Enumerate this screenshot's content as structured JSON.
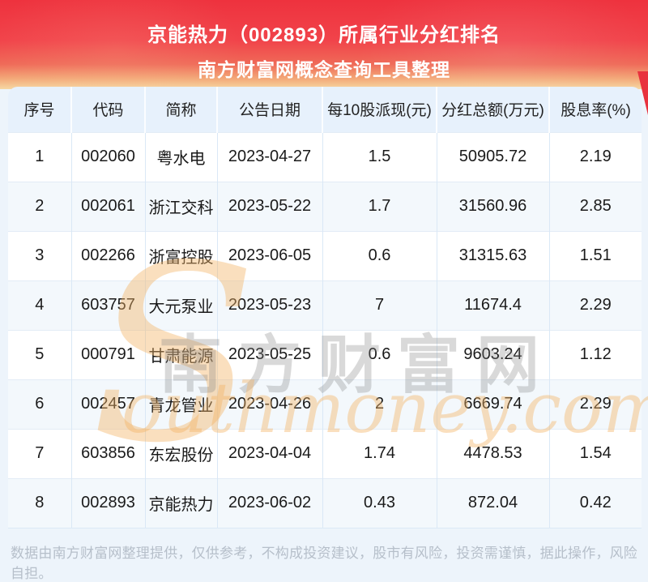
{
  "banner": {
    "title": "京能热力（002893）所属行业分红排名",
    "subtitle": "南方财富网概念查询工具整理"
  },
  "chart_data": {
    "type": "table",
    "title": "京能热力（002893）所属行业分红排名",
    "subtitle": "南方财富网概念查询工具整理",
    "columns": [
      "序号",
      "代码",
      "简称",
      "公告日期",
      "每10股派现(元)",
      "分红总额(万元)",
      "股息率(%)"
    ],
    "rows": [
      [
        "1",
        "002060",
        "粤水电",
        "2023-04-27",
        "1.5",
        "50905.72",
        "2.19"
      ],
      [
        "2",
        "002061",
        "浙江交科",
        "2023-05-22",
        "1.7",
        "31560.96",
        "2.85"
      ],
      [
        "3",
        "002266",
        "浙富控股",
        "2023-06-05",
        "0.6",
        "31315.63",
        "1.51"
      ],
      [
        "4",
        "603757",
        "大元泵业",
        "2023-05-23",
        "7",
        "11674.4",
        "2.29"
      ],
      [
        "5",
        "000791",
        "甘肃能源",
        "2023-05-25",
        "0.6",
        "9603.24",
        "1.12"
      ],
      [
        "6",
        "002457",
        "青龙管业",
        "2023-04-26",
        "2",
        "6669.74",
        "2.29"
      ],
      [
        "7",
        "603856",
        "东宏股份",
        "2023-04-04",
        "1.74",
        "4478.53",
        "1.54"
      ],
      [
        "8",
        "002893",
        "京能热力",
        "2023-06-02",
        "0.43",
        "872.04",
        "0.42"
      ]
    ]
  },
  "watermark": {
    "cn": "南方财富网",
    "latin_initial": "S",
    "latin_rest": "outhmoney.com"
  },
  "footer": {
    "disclaimer": "数据由南方财富网整理提供，仅供参考，不构成投资建议，股市有风险，投资需谨慎，据此操作，风险自担。"
  },
  "colors": {
    "banner_red": "#ee323e",
    "banner_cream": "#f6d8a3",
    "header_bg": "#e7f1fc",
    "row_alt_bg": "#f3f8fc",
    "page_bg": "#edf4fb",
    "watermark_orange": "#f3b264",
    "watermark_gray": "#808080",
    "footer_text": "#b6bfca"
  }
}
